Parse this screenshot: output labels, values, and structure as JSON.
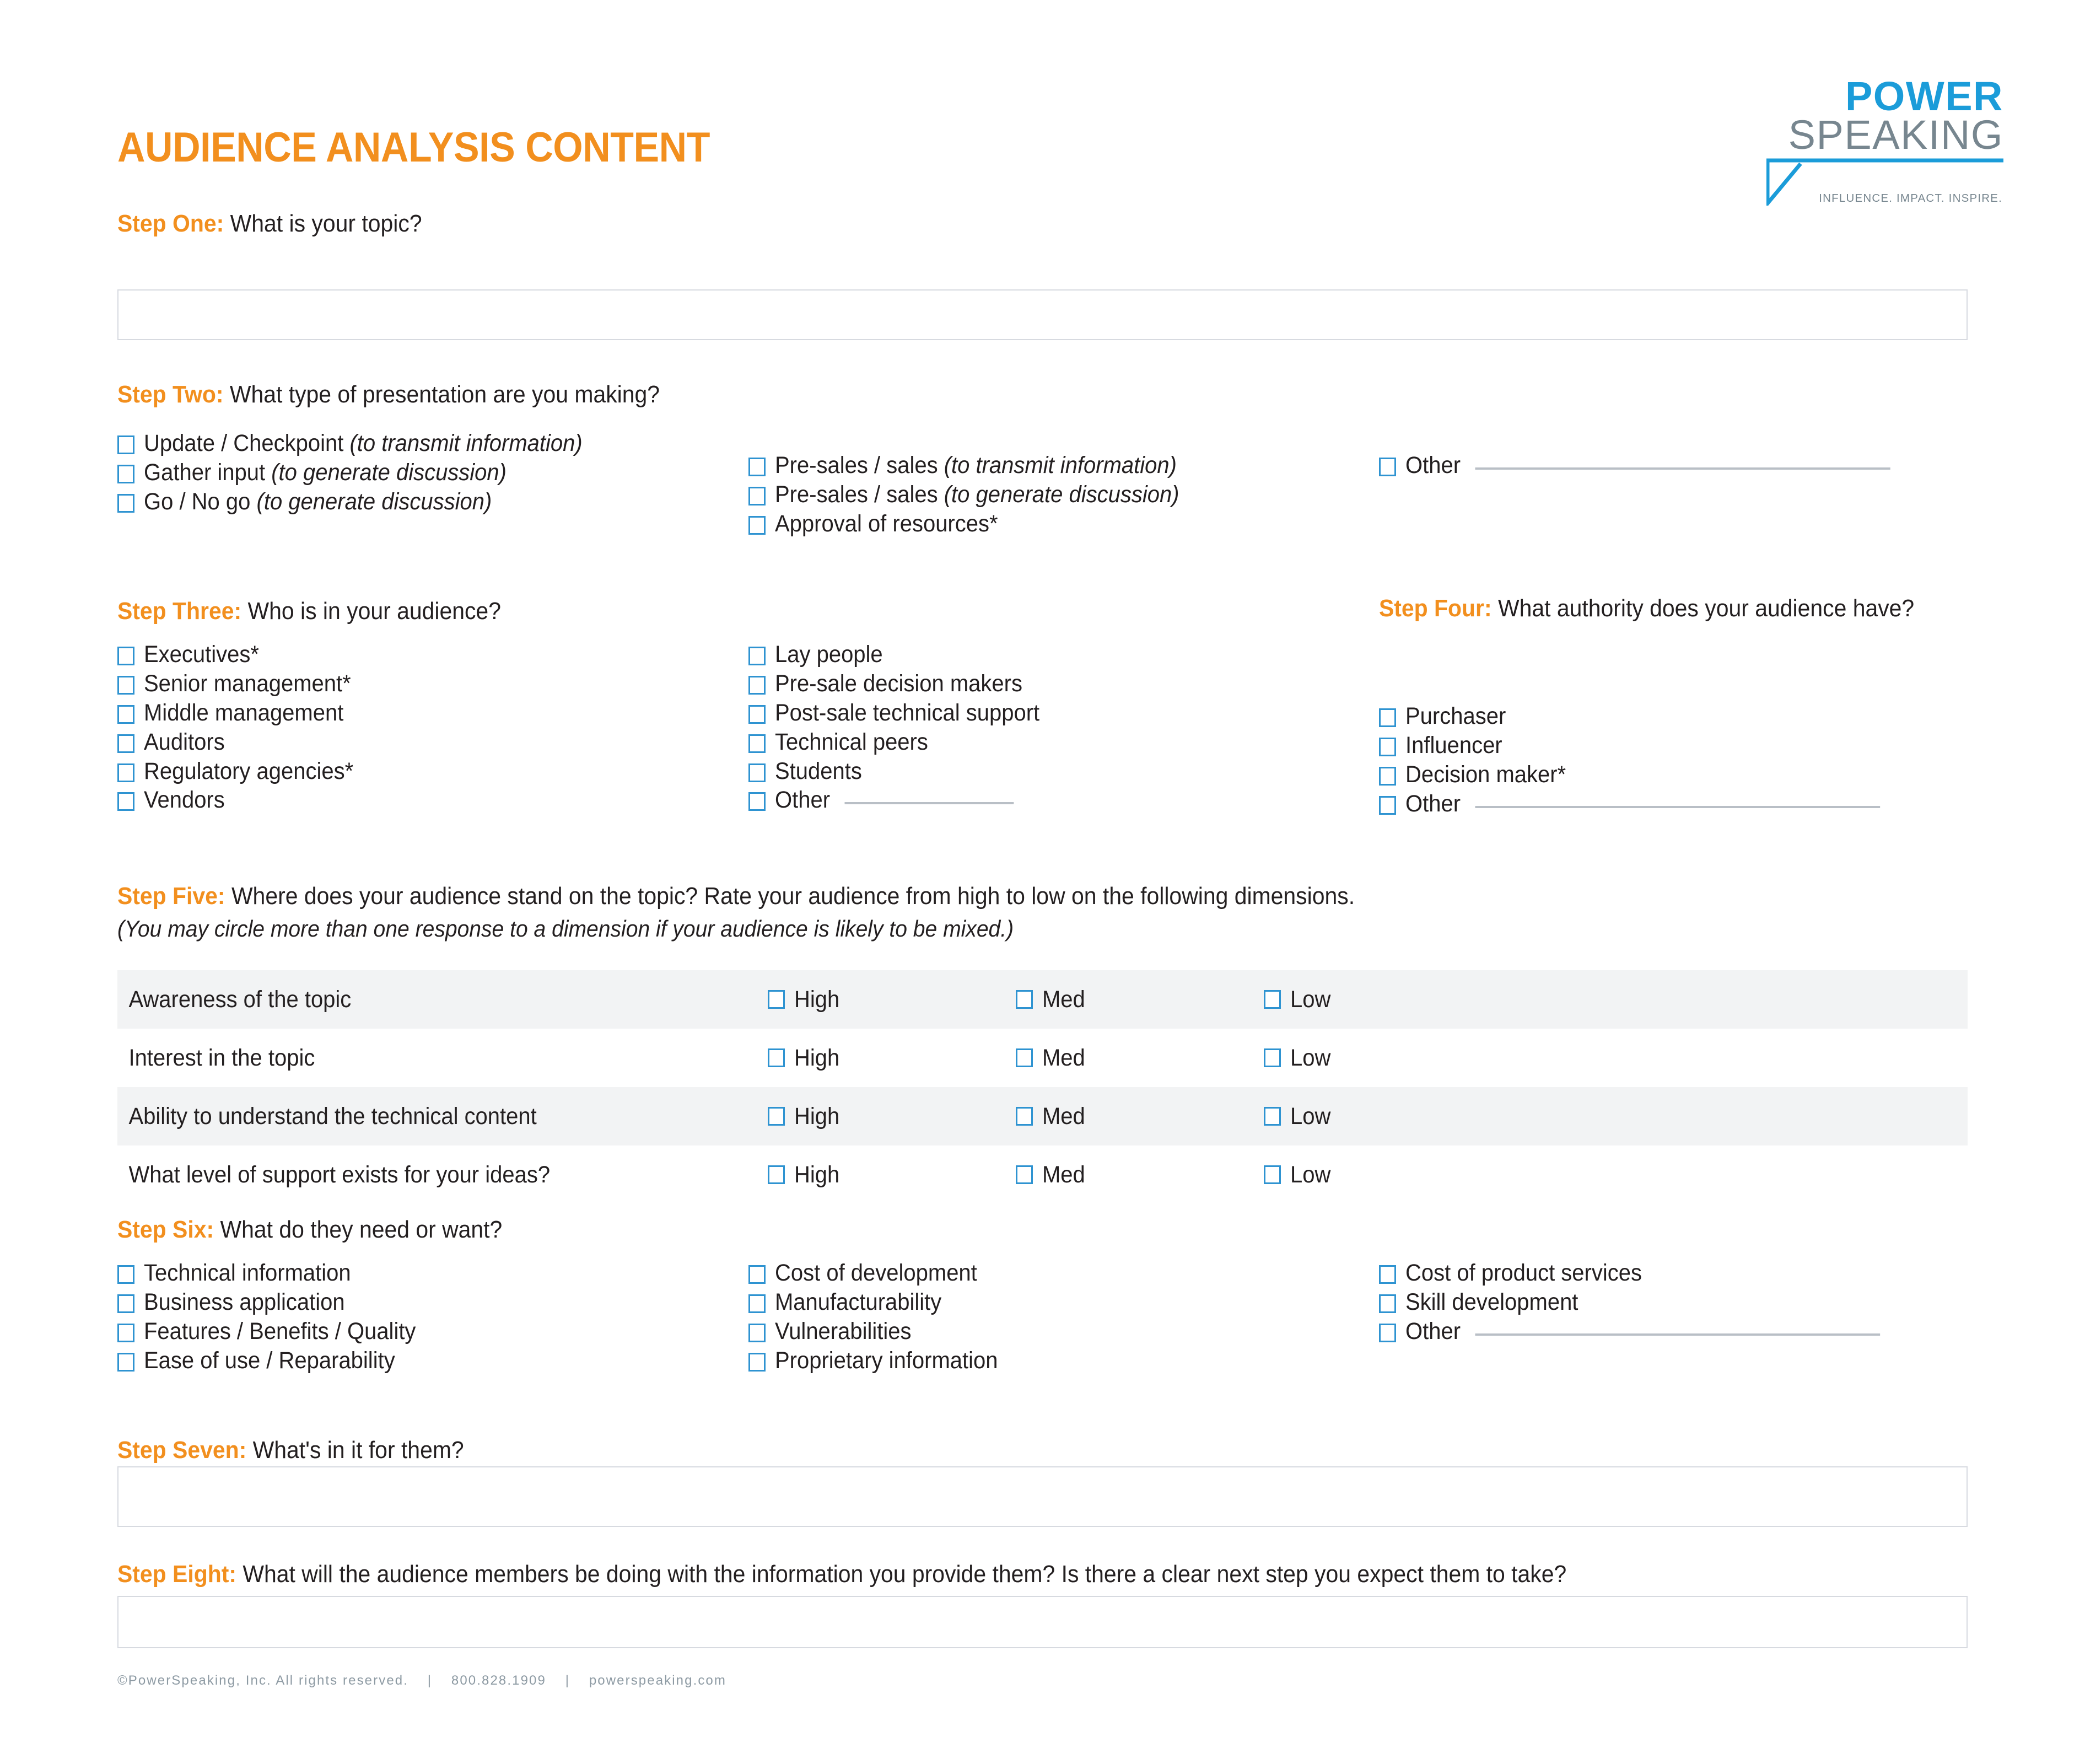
{
  "document": {
    "title": "AUDIENCE ANALYSIS CONTENT",
    "accent_color": "#F28F1E",
    "checkbox_color": "#2E93D1",
    "brand_blue": "#1B9CD9",
    "brand_gray": "#77868F"
  },
  "logo": {
    "line1": "POWER",
    "line2": "SPEAKING",
    "tagline": "INFLUENCE. IMPACT. INSPIRE."
  },
  "steps": {
    "one": {
      "label": "Step One:",
      "question": "What is your topic?",
      "answer": "",
      "placeholder": ""
    },
    "two": {
      "label": "Step Two:",
      "question": "What type of presentation are you making?",
      "col1": [
        {
          "text": "Update / Checkpoint ",
          "em": "(to transmit information)"
        },
        {
          "text": "Gather input ",
          "em": "(to generate discussion)"
        },
        {
          "text": "Go / No go ",
          "em": "(to generate discussion)"
        }
      ],
      "col2": [
        {
          "text": "Pre-sales / sales ",
          "em": "(to transmit information)"
        },
        {
          "text": "Pre-sales / sales ",
          "em": "(to generate discussion)"
        },
        {
          "text": "Approval of resources*",
          "em": ""
        }
      ],
      "col3": [
        {
          "text": "Other",
          "em": "",
          "line": true
        }
      ]
    },
    "three": {
      "label": "Step Three:",
      "question": "Who is in your audience?",
      "col1": [
        {
          "text": "Executives*"
        },
        {
          "text": "Senior management*"
        },
        {
          "text": "Middle management"
        },
        {
          "text": "Auditors"
        },
        {
          "text": "Regulatory agencies*"
        },
        {
          "text": "Vendors"
        }
      ],
      "col2": [
        {
          "text": "Lay people"
        },
        {
          "text": "Pre-sale decision makers"
        },
        {
          "text": "Post-sale technical support"
        },
        {
          "text": "Technical peers"
        },
        {
          "text": "Students"
        },
        {
          "text": "Other",
          "line": true
        }
      ]
    },
    "four": {
      "label": "Step Four:",
      "question": "What authority does your audience have?",
      "items": [
        {
          "text": "Purchaser"
        },
        {
          "text": "Influencer"
        },
        {
          "text": "Decision maker*"
        },
        {
          "text": "Other",
          "line": true
        }
      ]
    },
    "five": {
      "label": "Step Five:",
      "question": "Where does your audience stand on the topic? Rate your audience from high to low on the following dimensions.",
      "note": "(You may circle more than one response to a dimension if your audience is likely to be mixed.)",
      "options": [
        "High",
        "Med",
        "Low"
      ],
      "rows": [
        "Awareness of the topic",
        "Interest in the topic",
        "Ability to understand the technical content",
        "What level of support exists for your ideas?"
      ]
    },
    "six": {
      "label": "Step Six:",
      "question": "What do they need or want?",
      "col1": [
        {
          "text": "Technical information"
        },
        {
          "text": "Business application"
        },
        {
          "text": "Features / Benefits / Quality"
        },
        {
          "text": "Ease of use / Reparability"
        }
      ],
      "col2": [
        {
          "text": "Cost of development"
        },
        {
          "text": "Manufacturability"
        },
        {
          "text": "Vulnerabilities"
        },
        {
          "text": "Proprietary information"
        }
      ],
      "col3": [
        {
          "text": "Cost of product services"
        },
        {
          "text": "Skill development"
        },
        {
          "text": "Other",
          "line": true
        }
      ]
    },
    "seven": {
      "label": "Step Seven:",
      "question": "What's in it for them?",
      "answer": "",
      "placeholder": ""
    },
    "eight": {
      "label": "Step Eight:",
      "question": "What will the audience members be doing with the information you provide them? Is there a clear next step you expect them to take?",
      "answer": "",
      "placeholder": ""
    }
  },
  "footer": {
    "copyright": "©PowerSpeaking, Inc. All rights reserved.",
    "separator": "|",
    "phone": "800.828.1909",
    "website": "powerspeaking.com"
  }
}
